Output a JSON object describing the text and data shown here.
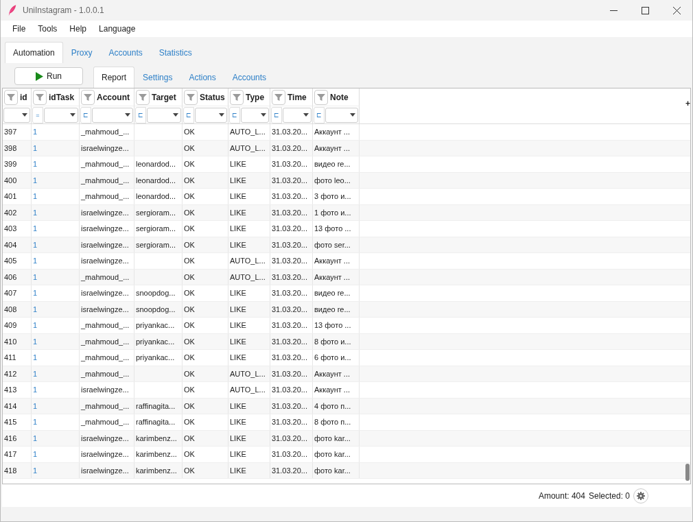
{
  "window": {
    "title": "UniInstagram - 1.0.0.1"
  },
  "menu": [
    "File",
    "Tools",
    "Help",
    "Language"
  ],
  "tabs": [
    {
      "label": "Automation",
      "selected": true
    },
    {
      "label": "Proxy",
      "selected": false
    },
    {
      "label": "Accounts",
      "selected": false
    },
    {
      "label": "Statistics",
      "selected": false
    }
  ],
  "run_button": "Run",
  "subtabs": [
    {
      "label": "Report",
      "selected": true
    },
    {
      "label": "Settings",
      "selected": false
    },
    {
      "label": "Actions",
      "selected": false
    },
    {
      "label": "Accounts",
      "selected": false
    }
  ],
  "table": {
    "columns": [
      {
        "title": "id"
      },
      {
        "title": "idTask",
        "operator": "="
      },
      {
        "title": "Account",
        "operator": "⊏"
      },
      {
        "title": "Target",
        "operator": "⊏"
      },
      {
        "title": "Status",
        "operator": "⊏"
      },
      {
        "title": "Type",
        "operator": "⊏"
      },
      {
        "title": "Time",
        "operator": "⊏"
      },
      {
        "title": "Note",
        "operator": "⊏"
      }
    ],
    "add_column": "+",
    "rows": [
      [
        "397",
        "1",
        "_mahmoud_...",
        "",
        "OK",
        "AUTO_L...",
        "31.03.20...",
        "Аккаунт ..."
      ],
      [
        "398",
        "1",
        "israelwingze...",
        "",
        "OK",
        "AUTO_L...",
        "31.03.20...",
        "Аккаунт ..."
      ],
      [
        "399",
        "1",
        "_mahmoud_...",
        "leonardod...",
        "OK",
        "LIKE",
        "31.03.20...",
        "видео re..."
      ],
      [
        "400",
        "1",
        "_mahmoud_...",
        "leonardod...",
        "OK",
        "LIKE",
        "31.03.20...",
        "фото leo..."
      ],
      [
        "401",
        "1",
        "_mahmoud_...",
        "leonardod...",
        "OK",
        "LIKE",
        "31.03.20...",
        "3 фото и..."
      ],
      [
        "402",
        "1",
        "israelwingze...",
        "sergioram...",
        "OK",
        "LIKE",
        "31.03.20...",
        "1 фото и..."
      ],
      [
        "403",
        "1",
        "israelwingze...",
        "sergioram...",
        "OK",
        "LIKE",
        "31.03.20...",
        "13 фото ..."
      ],
      [
        "404",
        "1",
        "israelwingze...",
        "sergioram...",
        "OK",
        "LIKE",
        "31.03.20...",
        "фото ser..."
      ],
      [
        "405",
        "1",
        "israelwingze...",
        "",
        "OK",
        "AUTO_L...",
        "31.03.20...",
        "Аккаунт ..."
      ],
      [
        "406",
        "1",
        "_mahmoud_...",
        "",
        "OK",
        "AUTO_L...",
        "31.03.20...",
        "Аккаунт ..."
      ],
      [
        "407",
        "1",
        "israelwingze...",
        "snoopdog...",
        "OK",
        "LIKE",
        "31.03.20...",
        "видео re..."
      ],
      [
        "408",
        "1",
        "israelwingze...",
        "snoopdog...",
        "OK",
        "LIKE",
        "31.03.20...",
        "видео re..."
      ],
      [
        "409",
        "1",
        "_mahmoud_...",
        "priyankac...",
        "OK",
        "LIKE",
        "31.03.20...",
        "13 фото ..."
      ],
      [
        "410",
        "1",
        "_mahmoud_...",
        "priyankac...",
        "OK",
        "LIKE",
        "31.03.20...",
        "8 фото и..."
      ],
      [
        "411",
        "1",
        "_mahmoud_...",
        "priyankac...",
        "OK",
        "LIKE",
        "31.03.20...",
        "6 фото и..."
      ],
      [
        "412",
        "1",
        "_mahmoud_...",
        "",
        "OK",
        "AUTO_L...",
        "31.03.20...",
        "Аккаунт ..."
      ],
      [
        "413",
        "1",
        "israelwingze...",
        "",
        "OK",
        "AUTO_L...",
        "31.03.20...",
        "Аккаунт ..."
      ],
      [
        "414",
        "1",
        "_mahmoud_...",
        "raffinagita...",
        "OK",
        "LIKE",
        "31.03.20...",
        "4 фото п..."
      ],
      [
        "415",
        "1",
        "_mahmoud_...",
        "raffinagita...",
        "OK",
        "LIKE",
        "31.03.20...",
        "8 фото п..."
      ],
      [
        "416",
        "1",
        "israelwingze...",
        "karimbenz...",
        "OK",
        "LIKE",
        "31.03.20...",
        "фото kar..."
      ],
      [
        "417",
        "1",
        "israelwingze...",
        "karimbenz...",
        "OK",
        "LIKE",
        "31.03.20...",
        "фото kar..."
      ],
      [
        "418",
        "1",
        "israelwingze...",
        "karimbenz...",
        "OK",
        "LIKE",
        "31.03.20...",
        "фото kar..."
      ]
    ]
  },
  "status_bar": {
    "amount": "Amount: 404",
    "selected": "Selected: 0"
  }
}
